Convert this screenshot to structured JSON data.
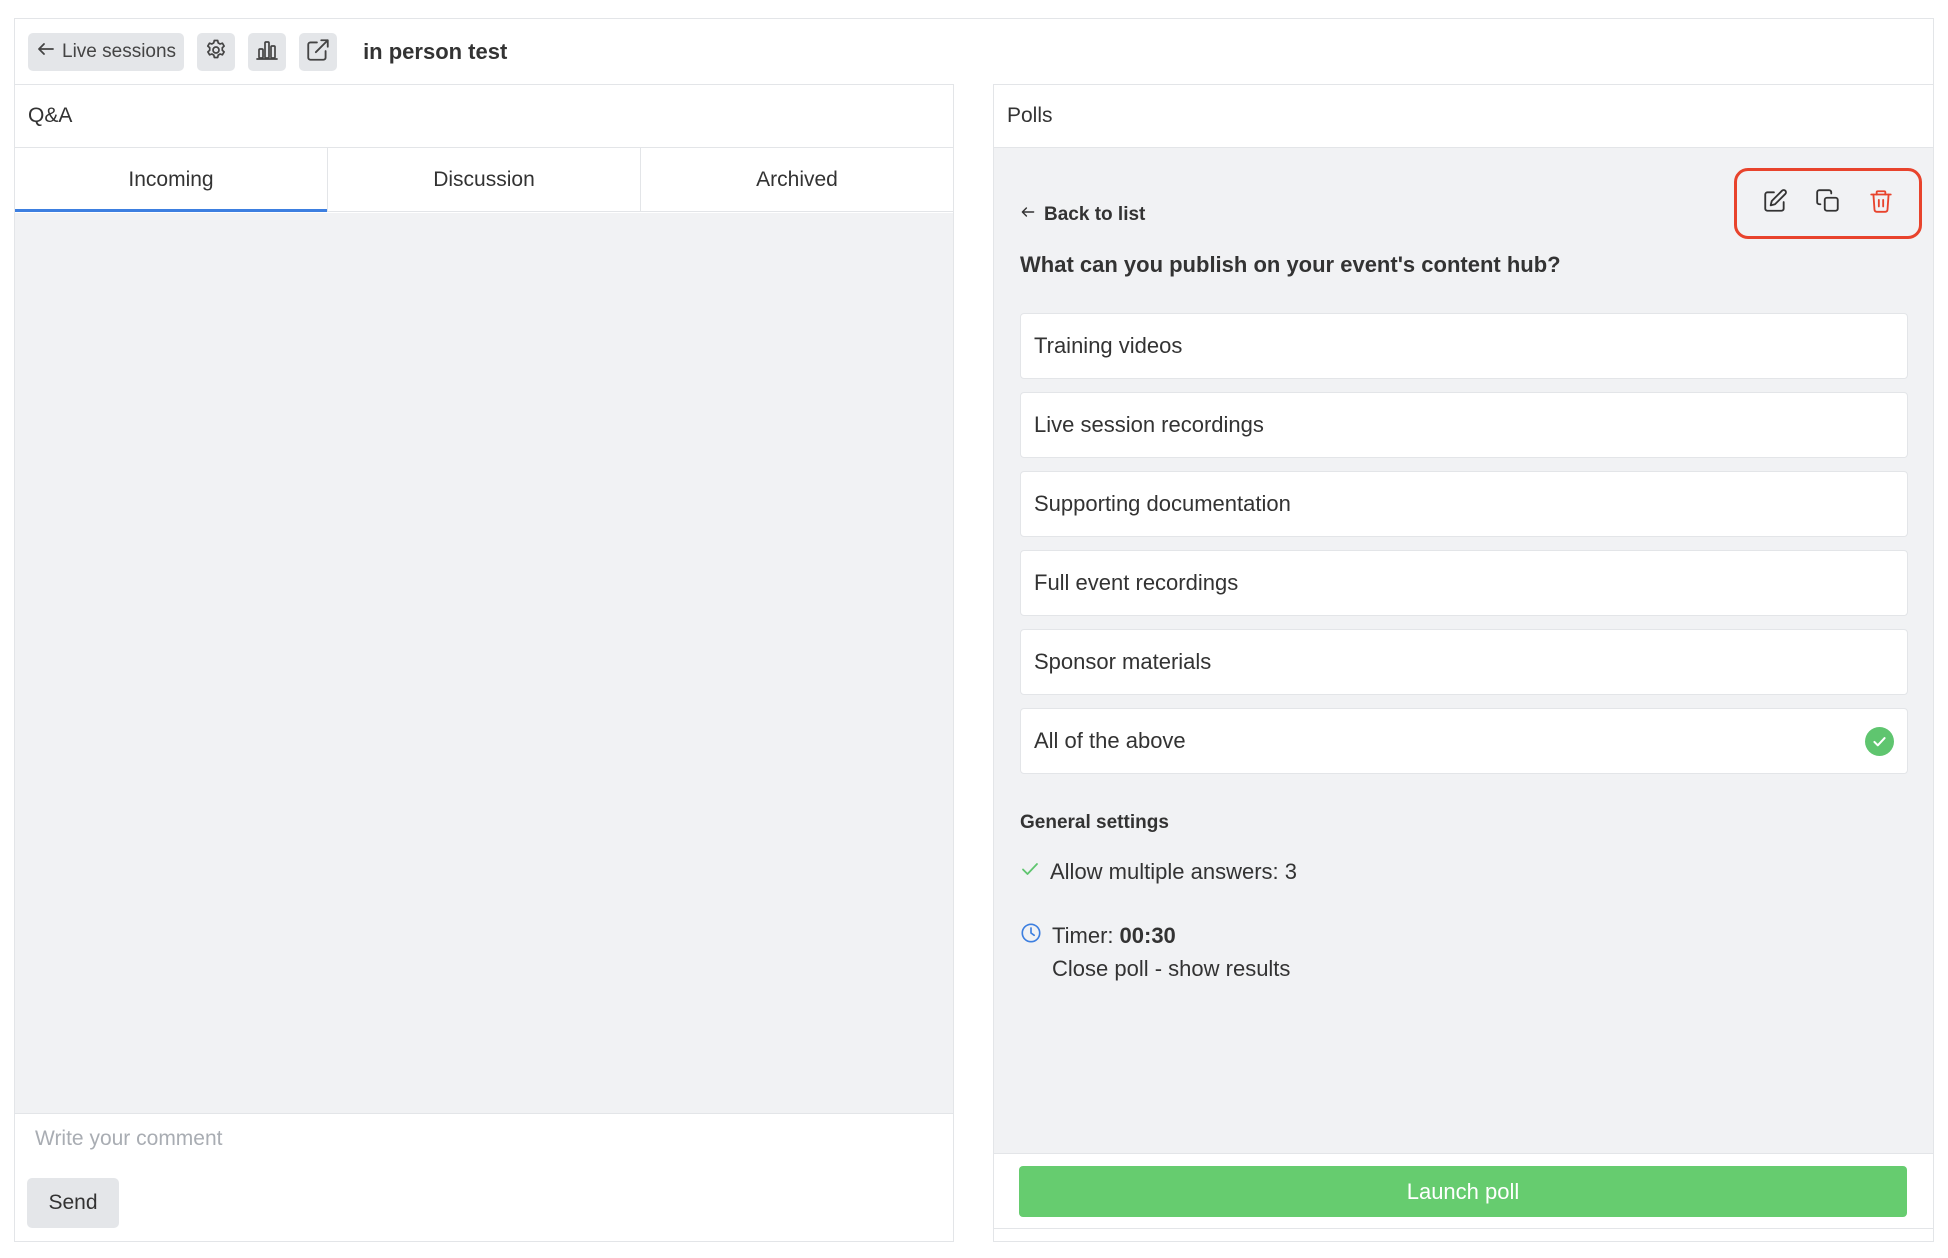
{
  "header": {
    "back_label": "Live sessions",
    "event_title": "in person test",
    "icons": [
      "arrow-left-icon",
      "gear-icon",
      "bar-chart-icon",
      "external-link-icon"
    ]
  },
  "qa": {
    "title": "Q&A",
    "tabs": [
      {
        "label": "Incoming",
        "active": true
      },
      {
        "label": "Discussion",
        "active": false
      },
      {
        "label": "Archived",
        "active": false
      }
    ],
    "comment_placeholder": "Write your comment",
    "send_label": "Send"
  },
  "polls": {
    "title": "Polls",
    "back_label": "Back to list",
    "action_icons": [
      "edit-icon",
      "copy-icon",
      "trash-icon"
    ],
    "question": "What can you publish on your event's content hub?",
    "options": [
      {
        "label": "Training videos",
        "correct": false
      },
      {
        "label": "Live session recordings",
        "correct": false
      },
      {
        "label": "Supporting documentation",
        "correct": false
      },
      {
        "label": "Full event recordings",
        "correct": false
      },
      {
        "label": "Sponsor materials",
        "correct": false
      },
      {
        "label": "All of the above",
        "correct": true
      }
    ],
    "settings_heading": "General settings",
    "multiple_answers": "Allow multiple answers: 3",
    "timer_label": "Timer:",
    "timer_value": "00:30",
    "timer_action": "Close poll - show results",
    "launch_label": "Launch poll"
  },
  "colors": {
    "accent_blue": "#3d7fe0",
    "launch_green": "#66cc6f",
    "check_green": "#5fc56f",
    "highlight_red": "#e8432c",
    "panel_gray": "#f1f2f4"
  }
}
